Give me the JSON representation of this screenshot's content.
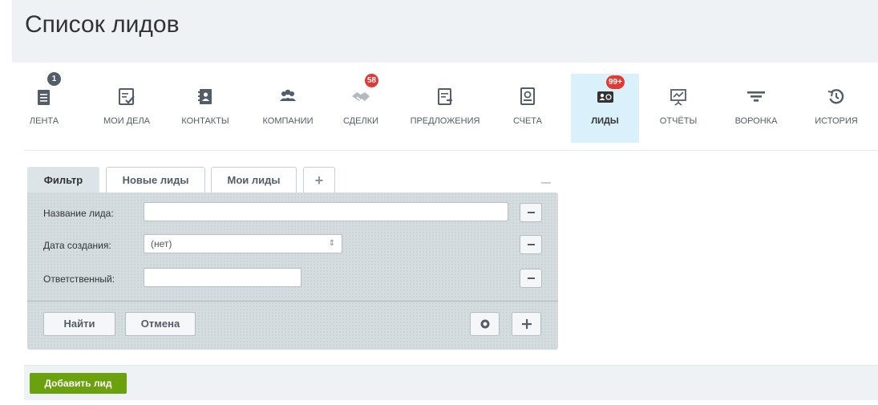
{
  "page": {
    "title": "Список лидов"
  },
  "nav": {
    "items": [
      {
        "label": "ЛЕНТА",
        "icon": "feed-icon",
        "badge": "1"
      },
      {
        "label": "МОИ ДЕЛА",
        "icon": "tasks-icon"
      },
      {
        "label": "КОНТАКТЫ",
        "icon": "contacts-icon"
      },
      {
        "label": "КОМПАНИИ",
        "icon": "companies-icon"
      },
      {
        "label": "СДЕЛКИ",
        "icon": "deals-icon",
        "badge": "58"
      },
      {
        "label": "ПРЕДЛОЖЕНИЯ",
        "icon": "offers-icon"
      },
      {
        "label": "СЧЕТА",
        "icon": "invoices-icon"
      },
      {
        "label": "ЛИДЫ",
        "icon": "leads-icon",
        "badge": "99+",
        "active": true
      },
      {
        "label": "ОТЧЁТЫ",
        "icon": "reports-icon"
      },
      {
        "label": "ВОРОНКА",
        "icon": "funnel-icon"
      },
      {
        "label": "ИСТОРИЯ",
        "icon": "history-icon"
      }
    ]
  },
  "filter": {
    "tabs": [
      "Фильтр",
      "Новые лиды",
      "Мои лиды",
      "+"
    ],
    "fields": {
      "name_label": "Название лида:",
      "name_value": "",
      "date_label": "Дата создания:",
      "date_value": "(нет)",
      "owner_label": "Ответственный:",
      "owner_value": ""
    },
    "find_label": "Найти",
    "cancel_label": "Отмена"
  },
  "footer": {
    "add_label": "Добавить лид"
  },
  "colors": {
    "accent": "#6ba10c",
    "badge": "#e23935",
    "active_tab": "#daf0fb"
  }
}
